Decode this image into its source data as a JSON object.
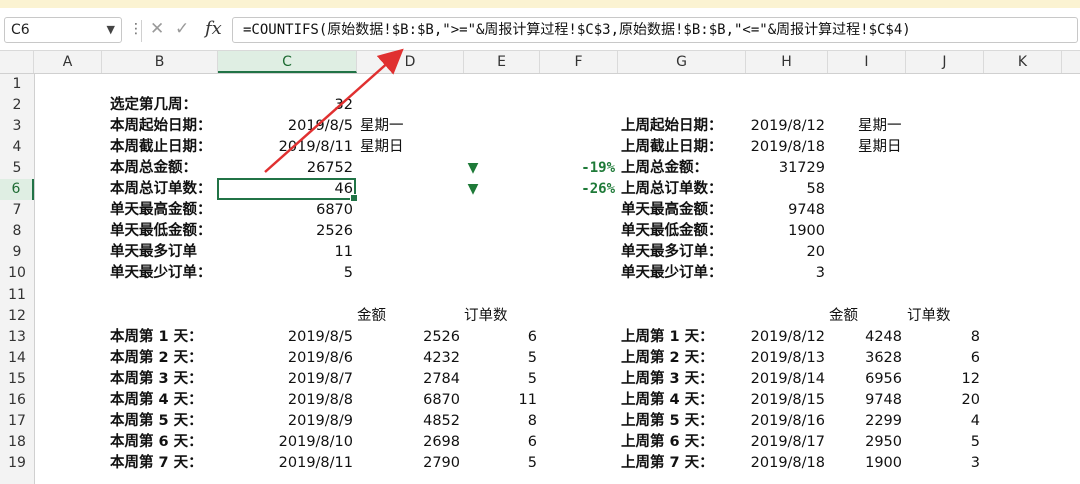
{
  "formula_bar": {
    "name_box": "C6",
    "formula": "=COUNTIFS(原始数据!$B:$B,\">=\"&周报计算过程!$C$3,原始数据!$B:$B,\"<=\"&周报计算过程!$C$4)"
  },
  "columns": [
    "A",
    "B",
    "C",
    "D",
    "E",
    "F",
    "G",
    "H",
    "I",
    "J",
    "K"
  ],
  "rows": [
    "1",
    "2",
    "3",
    "4",
    "5",
    "6",
    "7",
    "8",
    "9",
    "10",
    "11",
    "12",
    "13",
    "14",
    "15",
    "16",
    "17",
    "18",
    "19"
  ],
  "selected": {
    "column": "C",
    "row": "6"
  },
  "colors": {
    "accent": "#217346",
    "arrow": "#e03030",
    "down": "#1e7a38"
  },
  "summary_left": [
    {
      "label": "选定第几周：",
      "value": "32",
      "extra": ""
    },
    {
      "label": "本周起始日期：",
      "value": "2019/8/5",
      "extra": "星期一"
    },
    {
      "label": "本周截止日期：",
      "value": "2019/8/11",
      "extra": "星期日"
    },
    {
      "label": "本周总金额：",
      "value": "26752",
      "extra": ""
    },
    {
      "label": "本周总订单数：",
      "value": "46",
      "extra": ""
    },
    {
      "label": "单天最高金额：",
      "value": "6870",
      "extra": ""
    },
    {
      "label": "单天最低金额：",
      "value": "2526",
      "extra": ""
    },
    {
      "label": "单天最多订单",
      "value": "11",
      "extra": ""
    },
    {
      "label": "单天最少订单：",
      "value": "5",
      "extra": ""
    }
  ],
  "comparison": [
    {
      "arrow": "▼",
      "pct": "-19%"
    },
    {
      "arrow": "▼",
      "pct": "-26%"
    }
  ],
  "summary_right": [
    {
      "label": "上周起始日期：",
      "value": "2019/8/12",
      "extra": "星期一"
    },
    {
      "label": "上周截止日期：",
      "value": "2019/8/18",
      "extra": "星期日"
    },
    {
      "label": "上周总金额：",
      "value": "31729",
      "extra": ""
    },
    {
      "label": "上周总订单数：",
      "value": "58",
      "extra": ""
    },
    {
      "label": "单天最高金额：",
      "value": "9748",
      "extra": ""
    },
    {
      "label": "单天最低金额：",
      "value": "1900",
      "extra": ""
    },
    {
      "label": "单天最多订单：",
      "value": "20",
      "extra": ""
    },
    {
      "label": "单天最少订单：",
      "value": "3",
      "extra": ""
    }
  ],
  "daily_headers": {
    "amount": "金额",
    "orders": "订单数"
  },
  "daily_left": [
    {
      "label": "本周第 1 天：",
      "date": "2019/8/5",
      "amount": "2526",
      "orders": "6"
    },
    {
      "label": "本周第 2 天：",
      "date": "2019/8/6",
      "amount": "4232",
      "orders": "5"
    },
    {
      "label": "本周第 3 天：",
      "date": "2019/8/7",
      "amount": "2784",
      "orders": "5"
    },
    {
      "label": "本周第 4 天：",
      "date": "2019/8/8",
      "amount": "6870",
      "orders": "11"
    },
    {
      "label": "本周第 5 天：",
      "date": "2019/8/9",
      "amount": "4852",
      "orders": "8"
    },
    {
      "label": "本周第 6 天：",
      "date": "2019/8/10",
      "amount": "2698",
      "orders": "6"
    },
    {
      "label": "本周第 7 天：",
      "date": "2019/8/11",
      "amount": "2790",
      "orders": "5"
    }
  ],
  "daily_right": [
    {
      "label": "上周第 1 天：",
      "date": "2019/8/12",
      "amount": "4248",
      "orders": "8"
    },
    {
      "label": "上周第 2 天：",
      "date": "2019/8/13",
      "amount": "3628",
      "orders": "6"
    },
    {
      "label": "上周第 3 天：",
      "date": "2019/8/14",
      "amount": "6956",
      "orders": "12"
    },
    {
      "label": "上周第 4 天：",
      "date": "2019/8/15",
      "amount": "9748",
      "orders": "20"
    },
    {
      "label": "上周第 5 天：",
      "date": "2019/8/16",
      "amount": "2299",
      "orders": "4"
    },
    {
      "label": "上周第 6 天：",
      "date": "2019/8/17",
      "amount": "2950",
      "orders": "5"
    },
    {
      "label": "上周第 7 天：",
      "date": "2019/8/18",
      "amount": "1900",
      "orders": "3"
    }
  ]
}
